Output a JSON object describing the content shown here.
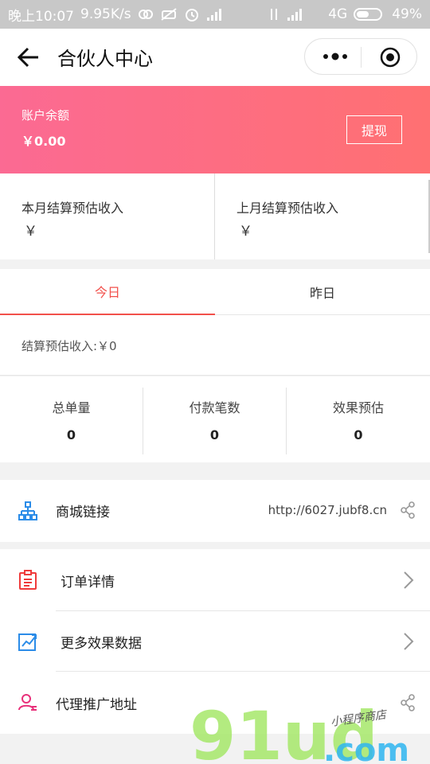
{
  "status_bar": {
    "time": "晚上10:07",
    "speed": "9.95K/s",
    "network": "4G",
    "battery": "49%"
  },
  "navbar": {
    "title": "合伙人中心"
  },
  "balance": {
    "label": "账户余额",
    "value": "￥0.00",
    "withdraw_label": "提现"
  },
  "income": {
    "this_month_label": "本月结算预估收入",
    "this_month_value": "￥",
    "last_month_label": "上月结算预估收入",
    "last_month_value": "￥"
  },
  "tabs": [
    {
      "label": "今日",
      "active": true
    },
    {
      "label": "昨日",
      "active": false
    }
  ],
  "settlement": {
    "text": "结算预估收入:￥0"
  },
  "stats": [
    {
      "label": "总单量",
      "value": "0"
    },
    {
      "label": "付款笔数",
      "value": "0"
    },
    {
      "label": "效果预估",
      "value": "0"
    }
  ],
  "menu": {
    "shop_link": {
      "label": "商城链接",
      "url": "http://6027.jubf8.cn",
      "icon": "sitemap-icon"
    },
    "order_detail": {
      "label": "订单详情",
      "icon": "clipboard-icon"
    },
    "more_data": {
      "label": "更多效果数据",
      "icon": "chart-icon"
    },
    "agent_link": {
      "label": "代理推广地址",
      "icon": "user-icon"
    }
  },
  "watermark": {
    "main": "91ud",
    "suffix": ".com",
    "tagline": "小程序商店"
  },
  "colors": {
    "accent": "#f2504b",
    "banner_start": "#fb6a93",
    "banner_end": "#ff7072",
    "watermark_green": "#a6e86a",
    "watermark_blue": "#2fb6f0"
  }
}
